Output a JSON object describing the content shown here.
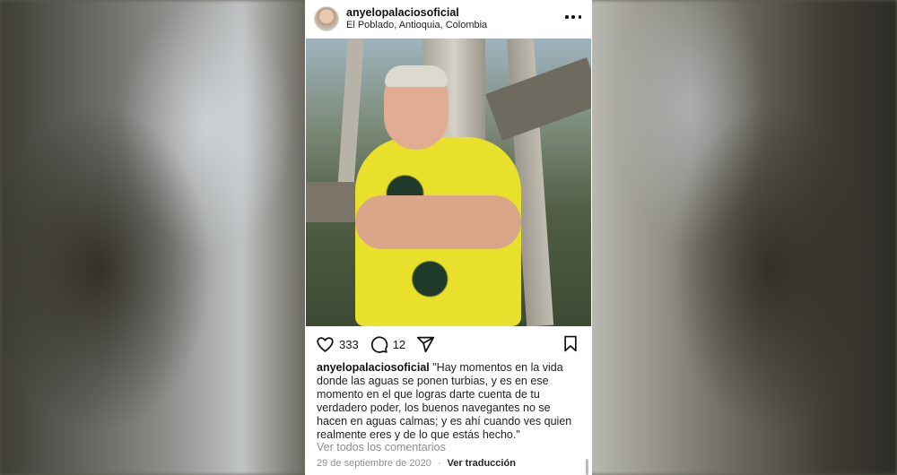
{
  "post": {
    "username": "anyelopalaciosoficial",
    "location": "El Poblado, Antioquia, Colombia",
    "likes": "333",
    "comments_count": "12",
    "caption_user": "anyelopalaciosoficial",
    "caption_text": "\"Hay momentos en la vida donde las aguas se ponen turbias, y es en ese momento en el que logras darte cuenta de tu verdadero poder, los buenos navegantes no se hacen en aguas calmas; y es ahí cuando ves quien realmente eres y de lo que estás hecho.\"",
    "view_comments": "Ver todos los comentarios",
    "date": "29 de septiembre de 2020",
    "separator": "·",
    "translate": "Ver traducción"
  },
  "icons": [
    "heart-icon",
    "comment-icon",
    "share-icon",
    "bookmark-icon",
    "more-options-icon"
  ]
}
